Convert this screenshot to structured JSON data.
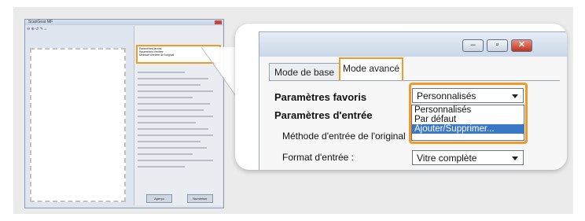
{
  "thumbnail": {
    "title": "ScanGear MF",
    "popup_items": [
      "Paramètres favoris",
      "Paramètres d'entrée",
      "Méthode d'entrée de l'original",
      "Personnalisés",
      "Par défaut",
      "Ajouter/Supprimer"
    ],
    "buttons": [
      "Aperçu",
      "Numériser"
    ]
  },
  "window": {
    "controls": {
      "minimize": "–",
      "maximize": "▫",
      "close": "✕"
    },
    "tabs": [
      {
        "label": "Mode de base",
        "active": false
      },
      {
        "label": "Mode avancé",
        "active": true
      }
    ],
    "favorites_label": "Paramètres favoris",
    "favorites_value": "Personnalisés",
    "favorites_options": [
      "Personnalisés",
      "Par défaut",
      "Ajouter/Supprimer..."
    ],
    "favorites_selected_index": 2,
    "input_settings_label": "Paramètres d'entrée",
    "input_method_label": "Méthode d'entrée de l'original :",
    "input_format_label": "Format d'entrée :",
    "input_format_value": "Vitre complète"
  },
  "colors": {
    "highlight": "#f09a2a",
    "selected_option": "#3a78c6"
  }
}
